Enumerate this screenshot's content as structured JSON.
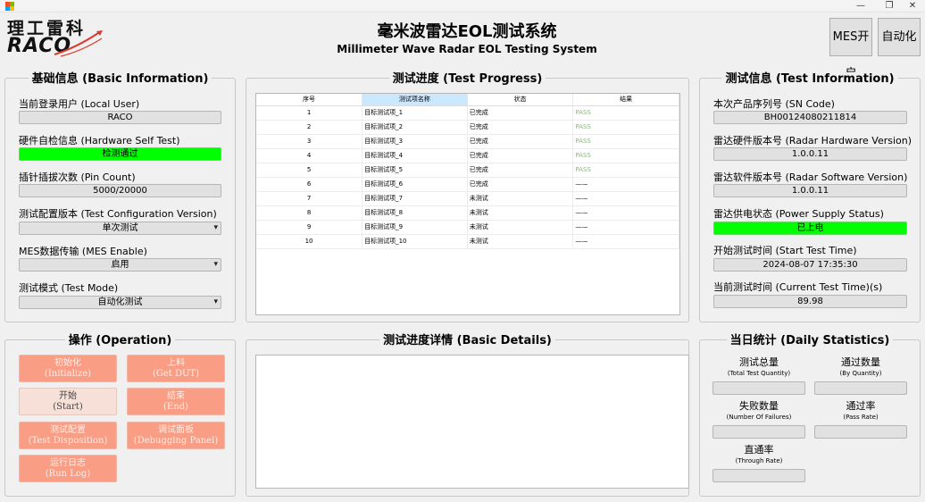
{
  "window": {
    "minimize": "—",
    "restore": "❐",
    "close": "✕"
  },
  "logo": {
    "cn": "理工雷科",
    "en": "RACO"
  },
  "header": {
    "title": "毫米波雷达EOL测试系统",
    "subtitle": "Millimeter Wave Radar EOL Testing System"
  },
  "top_buttons": {
    "mes_on": "MES开启",
    "automation": "自动化"
  },
  "basic_info": {
    "title": "基础信息 (Basic Information)",
    "user_label": "当前登录用户 (Local User)",
    "user_value": "RACO",
    "hw_test_label": "硬件自检信息 (Hardware Self Test)",
    "hw_test_value": "检测通过",
    "pin_label": "插针插拔次数 (Pin Count)",
    "pin_value": "5000/20000",
    "config_label": "测试配置版本 (Test Configuration Version)",
    "config_value": "单次测试",
    "mes_label": "MES数据传输 (MES Enable)",
    "mes_value": "启用",
    "mode_label": "测试模式 (Test Mode)",
    "mode_value": "自动化测试"
  },
  "progress": {
    "title": "测试进度 (Test Progress)",
    "columns": [
      "序号",
      "测试项名称",
      "状态",
      "结果"
    ],
    "rows": [
      [
        "1",
        "目标测试项_1",
        "已完成",
        "PASS"
      ],
      [
        "2",
        "目标测试项_2",
        "已完成",
        "PASS"
      ],
      [
        "3",
        "目标测试项_3",
        "已完成",
        "PASS"
      ],
      [
        "4",
        "目标测试项_4",
        "已完成",
        "PASS"
      ],
      [
        "5",
        "目标测试项_5",
        "已完成",
        "PASS"
      ],
      [
        "6",
        "目标测试项_6",
        "已完成",
        "——"
      ],
      [
        "7",
        "目标测试项_7",
        "未测试",
        "——"
      ],
      [
        "8",
        "目标测试项_8",
        "未测试",
        "——"
      ],
      [
        "9",
        "目标测试项_9",
        "未测试",
        "——"
      ],
      [
        "10",
        "目标测试项_10",
        "未测试",
        "——"
      ]
    ]
  },
  "test_info": {
    "title": "测试信息 (Test Information)",
    "sn_label": "本次产品序列号 (SN Code)",
    "sn_value": "BH00124080211814",
    "hw_ver_label": "雷达硬件版本号 (Radar Hardware Version)",
    "hw_ver_value": "1.0.0.11",
    "sw_ver_label": "雷达软件版本号 (Radar Software Version)",
    "sw_ver_value": "1.0.0.11",
    "power_label": "雷达供电状态 (Power Supply Status)",
    "power_value": "已上电",
    "start_label": "开始测试时间 (Start Test Time)",
    "start_value": "2024-08-07 17:35:30",
    "current_label": "当前测试时间 (Current Test Time)(s)",
    "current_value": "89.98"
  },
  "operation": {
    "title": "操作 (Operation)",
    "buttons": {
      "initialize": {
        "cn": "初始化",
        "en": "(Initialize)"
      },
      "get_dut": {
        "cn": "上料",
        "en": "(Get DUT)"
      },
      "start": {
        "cn": "开始",
        "en": "(Start)"
      },
      "end": {
        "cn": "结束",
        "en": "(End)"
      },
      "disposition": {
        "cn": "测试配置",
        "en": "(Test Disposition)"
      },
      "debugging": {
        "cn": "调试面板",
        "en": "(Debugging Panel)"
      },
      "run_log": {
        "cn": "运行日志",
        "en": "(Run Log)"
      }
    }
  },
  "details": {
    "title": "测试进度详情 (Basic Details)"
  },
  "stats": {
    "title": "当日统计 (Daily Statistics)",
    "total": {
      "label": "测试总量",
      "sub": "(Total Test Quantity)"
    },
    "passed": {
      "label": "通过数量",
      "sub": "(By Quantity)"
    },
    "failures": {
      "label": "失败数量",
      "sub": "(Number Of Failures)"
    },
    "pass_rate": {
      "label": "通过率",
      "sub": "(Pass Rate)"
    },
    "through_rate": {
      "label": "直通率",
      "sub": "(Through Rate)"
    }
  },
  "colors": {
    "accent_green": "#00ff00",
    "pass_green": "#87c26f",
    "button_salmon": "#fa9d85",
    "header_selected": "#cce8ff"
  }
}
